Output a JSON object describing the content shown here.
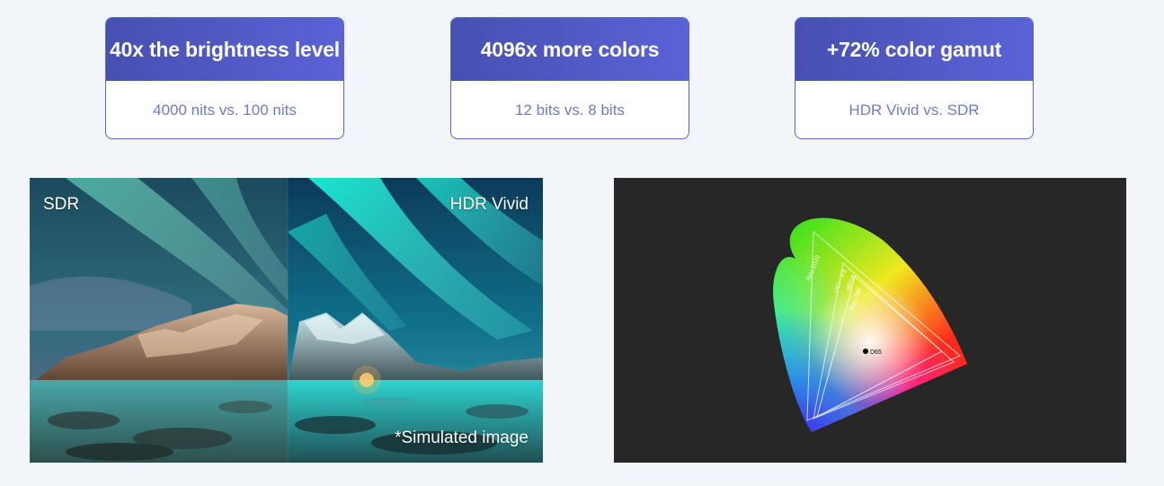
{
  "stats": [
    {
      "headline": "40x the brightness level",
      "detail": "4000 nits vs. 100 nits"
    },
    {
      "headline": "4096x more colors",
      "detail": "12 bits vs. 8 bits"
    },
    {
      "headline": "+72% color gamut",
      "detail": "HDR Vivid vs. SDR"
    }
  ],
  "comparison_image": {
    "left_label": "SDR",
    "right_label": "HDR Vivid",
    "note": "*Simulated image"
  },
  "gamut_diagram": {
    "labels": {
      "rec2020": "Rec.2020",
      "dci_p3": "DCI - P3",
      "srgb": "sRGB",
      "rec709": "Rec.709",
      "whitepoint": "D65"
    }
  },
  "colors": {
    "page_background": "#f2f5fa",
    "card_header_accent": "#4f5ac4",
    "card_border": "#5a66d3",
    "card_detail_text": "#6e7ad0",
    "gamut_background": "#272728"
  }
}
